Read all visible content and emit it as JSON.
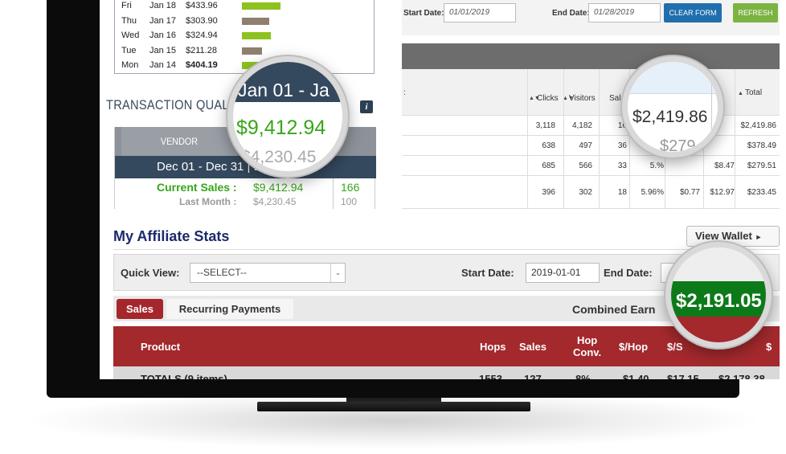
{
  "daily_sales": [
    {
      "day": "Fri",
      "date": "Jan 18",
      "amount": "$433.96",
      "bar_fraction": 0.92,
      "bar_color": "#8dc21f",
      "bold": false
    },
    {
      "day": "Thu",
      "date": "Jan 17",
      "amount": "$303.90",
      "bar_fraction": 0.66,
      "bar_color": "#8f7f6f",
      "bold": false
    },
    {
      "day": "Wed",
      "date": "Jan 16",
      "amount": "$324.94",
      "bar_fraction": 0.7,
      "bar_color": "#8dc21f",
      "bold": false
    },
    {
      "day": "Tue",
      "date": "Jan 15",
      "amount": "$211.28",
      "bar_fraction": 0.48,
      "bar_color": "#8f7f6f",
      "bold": false
    },
    {
      "day": "Mon",
      "date": "Jan 14",
      "amount": "$404.19",
      "bar_fraction": 0.87,
      "bar_color": "#8dc21f",
      "bold": true
    }
  ],
  "transaction_quality": {
    "title": "TRANSACTION QUALITY",
    "info_icon": "i",
    "vendor_header": "VENDOR",
    "range": "Dec 01 - Dec 31 | Dec 27",
    "current_label": "Current Sales :",
    "current_value": "$9,412.94",
    "current_count": "166",
    "last_label": "Last Month :",
    "last_value": "$4,230.45",
    "last_count": "100"
  },
  "report": {
    "start_label": "Start Date:",
    "start_value": "01/01/2019",
    "end_label": "End Date:",
    "end_value": "01/28/2019",
    "clear_label": "CLEAR FORM",
    "refresh_label": "REFRESH",
    "colon": ":",
    "headers": {
      "clicks": "Clicks",
      "visitors": "Visitors",
      "sales": "Sale",
      "total": "Total"
    },
    "rows": [
      {
        "clicks": "3,118",
        "visitors": "4,182",
        "sales": "16",
        "total": "$2,419.86"
      },
      {
        "clicks": "638",
        "visitors": "497",
        "sales": "36",
        "total": "$378.49"
      },
      {
        "clicks": "685",
        "visitors": "566",
        "sales": "33",
        "pct": "5.%",
        "c6": "$8.47",
        "total": "$279.51"
      },
      {
        "clicks": "396",
        "visitors": "302",
        "sales": "18",
        "pct": "5.96%",
        "c5": "$0.77",
        "c6": "$12.97",
        "total": "$233.45"
      }
    ]
  },
  "affiliate": {
    "title": "My Affiliate Stats",
    "wallet_label": "View Wallet",
    "quick_view_label": "Quick View:",
    "quick_view_value": "--SELECT--",
    "start_label": "Start Date:",
    "start_value": "2019-01-01",
    "end_label": "End Date:",
    "tab_sales": "Sales",
    "tab_recurring": "Recurring Payments",
    "combined_label": "Combined Earn",
    "columns": {
      "product": "Product",
      "hops": "Hops",
      "sales": "Sales",
      "hop_conv_1": "Hop",
      "hop_conv_2": "Conv.",
      "per_hop": "$/Hop",
      "per_sale": "$/S",
      "total": "$"
    },
    "totals": {
      "label": "TOTALS (9 items)",
      "hops": "1553",
      "sales": "127",
      "conv": "8%",
      "per_hop": "$1.40",
      "per_sale": "$17.15",
      "total": "$2,178.38"
    }
  },
  "magnifiers": {
    "lens1_range": "Jan 01 - Ja",
    "lens1_value": "$9,412.94",
    "lens1_ghost": "$4,230.45",
    "lens2_value": "$2,419.86",
    "lens2_ghost": "$279.",
    "lens3_value": "$2,191.05"
  }
}
